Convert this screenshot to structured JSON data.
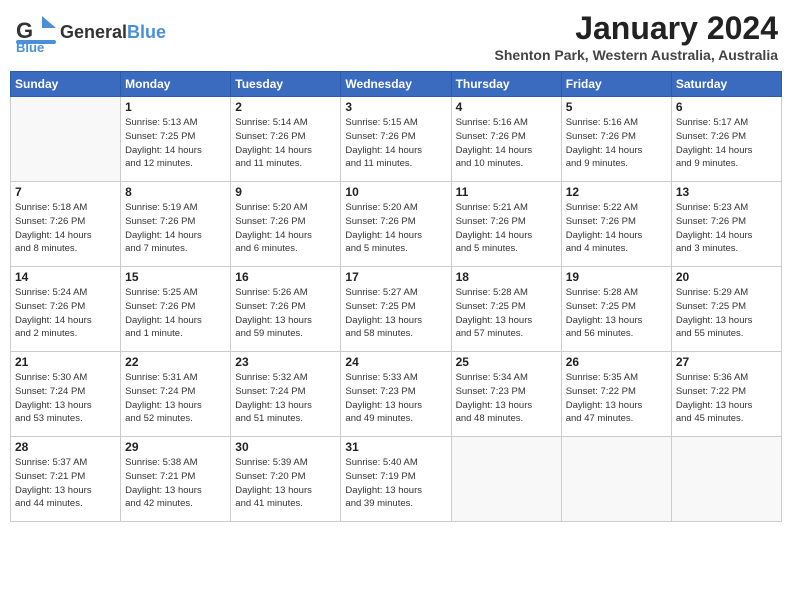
{
  "header": {
    "logo_text_general": "General",
    "logo_text_blue": "Blue",
    "month_year": "January 2024",
    "location": "Shenton Park, Western Australia, Australia"
  },
  "weekdays": [
    "Sunday",
    "Monday",
    "Tuesday",
    "Wednesday",
    "Thursday",
    "Friday",
    "Saturday"
  ],
  "weeks": [
    [
      {
        "day": "",
        "info": ""
      },
      {
        "day": "1",
        "info": "Sunrise: 5:13 AM\nSunset: 7:25 PM\nDaylight: 14 hours\nand 12 minutes."
      },
      {
        "day": "2",
        "info": "Sunrise: 5:14 AM\nSunset: 7:26 PM\nDaylight: 14 hours\nand 11 minutes."
      },
      {
        "day": "3",
        "info": "Sunrise: 5:15 AM\nSunset: 7:26 PM\nDaylight: 14 hours\nand 11 minutes."
      },
      {
        "day": "4",
        "info": "Sunrise: 5:16 AM\nSunset: 7:26 PM\nDaylight: 14 hours\nand 10 minutes."
      },
      {
        "day": "5",
        "info": "Sunrise: 5:16 AM\nSunset: 7:26 PM\nDaylight: 14 hours\nand 9 minutes."
      },
      {
        "day": "6",
        "info": "Sunrise: 5:17 AM\nSunset: 7:26 PM\nDaylight: 14 hours\nand 9 minutes."
      }
    ],
    [
      {
        "day": "7",
        "info": "Sunrise: 5:18 AM\nSunset: 7:26 PM\nDaylight: 14 hours\nand 8 minutes."
      },
      {
        "day": "8",
        "info": "Sunrise: 5:19 AM\nSunset: 7:26 PM\nDaylight: 14 hours\nand 7 minutes."
      },
      {
        "day": "9",
        "info": "Sunrise: 5:20 AM\nSunset: 7:26 PM\nDaylight: 14 hours\nand 6 minutes."
      },
      {
        "day": "10",
        "info": "Sunrise: 5:20 AM\nSunset: 7:26 PM\nDaylight: 14 hours\nand 5 minutes."
      },
      {
        "day": "11",
        "info": "Sunrise: 5:21 AM\nSunset: 7:26 PM\nDaylight: 14 hours\nand 5 minutes."
      },
      {
        "day": "12",
        "info": "Sunrise: 5:22 AM\nSunset: 7:26 PM\nDaylight: 14 hours\nand 4 minutes."
      },
      {
        "day": "13",
        "info": "Sunrise: 5:23 AM\nSunset: 7:26 PM\nDaylight: 14 hours\nand 3 minutes."
      }
    ],
    [
      {
        "day": "14",
        "info": "Sunrise: 5:24 AM\nSunset: 7:26 PM\nDaylight: 14 hours\nand 2 minutes."
      },
      {
        "day": "15",
        "info": "Sunrise: 5:25 AM\nSunset: 7:26 PM\nDaylight: 14 hours\nand 1 minute."
      },
      {
        "day": "16",
        "info": "Sunrise: 5:26 AM\nSunset: 7:26 PM\nDaylight: 13 hours\nand 59 minutes."
      },
      {
        "day": "17",
        "info": "Sunrise: 5:27 AM\nSunset: 7:25 PM\nDaylight: 13 hours\nand 58 minutes."
      },
      {
        "day": "18",
        "info": "Sunrise: 5:28 AM\nSunset: 7:25 PM\nDaylight: 13 hours\nand 57 minutes."
      },
      {
        "day": "19",
        "info": "Sunrise: 5:28 AM\nSunset: 7:25 PM\nDaylight: 13 hours\nand 56 minutes."
      },
      {
        "day": "20",
        "info": "Sunrise: 5:29 AM\nSunset: 7:25 PM\nDaylight: 13 hours\nand 55 minutes."
      }
    ],
    [
      {
        "day": "21",
        "info": "Sunrise: 5:30 AM\nSunset: 7:24 PM\nDaylight: 13 hours\nand 53 minutes."
      },
      {
        "day": "22",
        "info": "Sunrise: 5:31 AM\nSunset: 7:24 PM\nDaylight: 13 hours\nand 52 minutes."
      },
      {
        "day": "23",
        "info": "Sunrise: 5:32 AM\nSunset: 7:24 PM\nDaylight: 13 hours\nand 51 minutes."
      },
      {
        "day": "24",
        "info": "Sunrise: 5:33 AM\nSunset: 7:23 PM\nDaylight: 13 hours\nand 49 minutes."
      },
      {
        "day": "25",
        "info": "Sunrise: 5:34 AM\nSunset: 7:23 PM\nDaylight: 13 hours\nand 48 minutes."
      },
      {
        "day": "26",
        "info": "Sunrise: 5:35 AM\nSunset: 7:22 PM\nDaylight: 13 hours\nand 47 minutes."
      },
      {
        "day": "27",
        "info": "Sunrise: 5:36 AM\nSunset: 7:22 PM\nDaylight: 13 hours\nand 45 minutes."
      }
    ],
    [
      {
        "day": "28",
        "info": "Sunrise: 5:37 AM\nSunset: 7:21 PM\nDaylight: 13 hours\nand 44 minutes."
      },
      {
        "day": "29",
        "info": "Sunrise: 5:38 AM\nSunset: 7:21 PM\nDaylight: 13 hours\nand 42 minutes."
      },
      {
        "day": "30",
        "info": "Sunrise: 5:39 AM\nSunset: 7:20 PM\nDaylight: 13 hours\nand 41 minutes."
      },
      {
        "day": "31",
        "info": "Sunrise: 5:40 AM\nSunset: 7:19 PM\nDaylight: 13 hours\nand 39 minutes."
      },
      {
        "day": "",
        "info": ""
      },
      {
        "day": "",
        "info": ""
      },
      {
        "day": "",
        "info": ""
      }
    ]
  ]
}
